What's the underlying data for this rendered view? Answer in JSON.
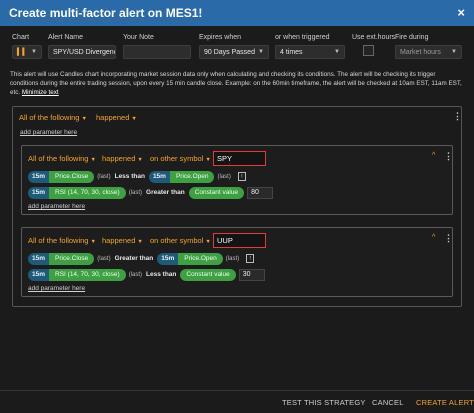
{
  "dialog": {
    "title": "Create multi-factor alert on MES1!",
    "close_glyph": "×"
  },
  "fields": {
    "chart": {
      "label": "Chart",
      "value": "▍▍"
    },
    "alert_name": {
      "label": "Alert Name",
      "value": "SPY/USD Divergenc"
    },
    "your_note": {
      "label": "Your Note",
      "value": ""
    },
    "expires_when": {
      "label": "Expires when",
      "value": "90 Days Passed"
    },
    "or_when_triggered": {
      "label": "or when triggered",
      "value": "4 times"
    },
    "use_ext_hours": {
      "label": "Use ext.hours",
      "checked": false
    },
    "fire_during": {
      "label": "Fire during",
      "value": "Market hours"
    }
  },
  "description": {
    "text": "This alert will use Candles chart incorporating market session data only when calculating and checking its conditions. The alert will be checking its trigger conditions during the entire trading session, upon every 15 min candle close. Example: on the 60min timeframe, the alert will be checked at 10am EST, 11am EST, etc.",
    "minimize_link": "Minimize text"
  },
  "outer": {
    "all_of_following": "All of the following",
    "happened": "happened",
    "add_parameter": "add parameter here"
  },
  "groups": [
    {
      "all_of_following": "All of the following",
      "happened": "happened",
      "on_other_symbol": "on other symbol",
      "symbol": "SPY",
      "conditions": [
        {
          "tf1": "15m",
          "ind1": "Price.Close",
          "last1": "(last)",
          "cmp": "Less than",
          "tf2": "15m",
          "ind2": "Price.Open",
          "last2": "(last)",
          "info": "!",
          "value": ""
        },
        {
          "tf1": "15m",
          "ind1": "RSI (14, 70, 30, close)",
          "last1": "(last)",
          "cmp": "Greater than",
          "cv": "Constant value",
          "info": "!",
          "value": "80"
        }
      ],
      "add_parameter": "add parameter here"
    },
    {
      "all_of_following": "All of the following",
      "happened": "happened",
      "on_other_symbol": "on other symbol",
      "symbol": "UUP",
      "conditions": [
        {
          "tf1": "15m",
          "ind1": "Price.Close",
          "last1": "(last)",
          "cmp": "Greater than",
          "tf2": "15m",
          "ind2": "Price.Open",
          "last2": "(last)",
          "info": "!",
          "value": ""
        },
        {
          "tf1": "15m",
          "ind1": "RSI (14, 70, 30, close)",
          "last1": "(last)",
          "cmp": "Less than",
          "cv": "Constant value",
          "info": "!",
          "value": "30"
        }
      ],
      "add_parameter": "add parameter here"
    }
  ],
  "footer": {
    "test_strategy": "TEST THIS STRATEGY",
    "cancel": "CANCEL",
    "create": "CREATE ALERT"
  },
  "colors": {
    "title_bar": "#2b6aa8",
    "accent": "#f5a623",
    "indicator_green": "#3ea043",
    "timeframe_blue": "#1f5b78",
    "symbol_highlight": "#e23b3b"
  }
}
